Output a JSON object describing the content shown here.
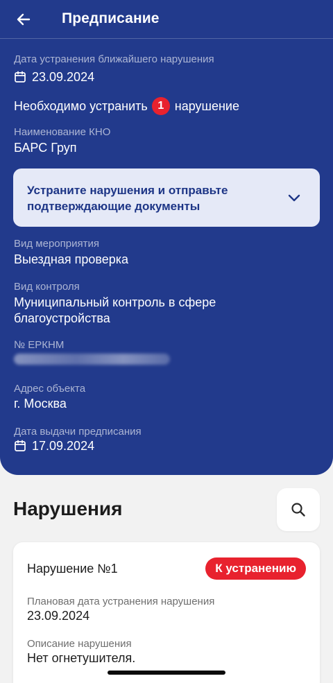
{
  "header": {
    "title": "Предписание"
  },
  "details": {
    "nearest_deadline_label": "Дата устранения ближайшего нарушения",
    "nearest_deadline_date": "23.09.2024",
    "need_prefix": "Необходимо устранить",
    "need_count": "1",
    "need_suffix": "нарушение",
    "kno_label": "Наименование КНО",
    "kno_value": "БАРС Груп",
    "action_card_text": "Устраните нарушения и отправьте подтверждающие документы",
    "event_type_label": "Вид мероприятия",
    "event_type_value": "Выездная проверка",
    "control_type_label": "Вид контроля",
    "control_type_value_line1": "Муниципальный контроль в сфере",
    "control_type_value_line2": "благоустройства",
    "erknm_label": "№ ЕРКНМ",
    "address_label": "Адрес объекта",
    "address_value": "г. Москва",
    "issue_date_label": "Дата выдачи предписания",
    "issue_date_value": "17.09.2024"
  },
  "violations": {
    "section_title": "Нарушения",
    "items": [
      {
        "title": "Нарушение №1",
        "status": "К устранению",
        "planned_date_label": "Плановая дата устранения нарушения",
        "planned_date_value": "23.09.2024",
        "description_label": "Описание нарушения",
        "description_value": "Нет огнетушителя."
      }
    ]
  },
  "colors": {
    "header_blue": "#223a8c",
    "accent_red": "#e8222e",
    "card_light": "#e5e9f7",
    "card_text_blue": "#1d3586"
  },
  "icons": {
    "back": "arrow-left-icon",
    "calendar": "calendar-icon",
    "chevron": "chevron-down-icon",
    "search": "search-icon"
  }
}
